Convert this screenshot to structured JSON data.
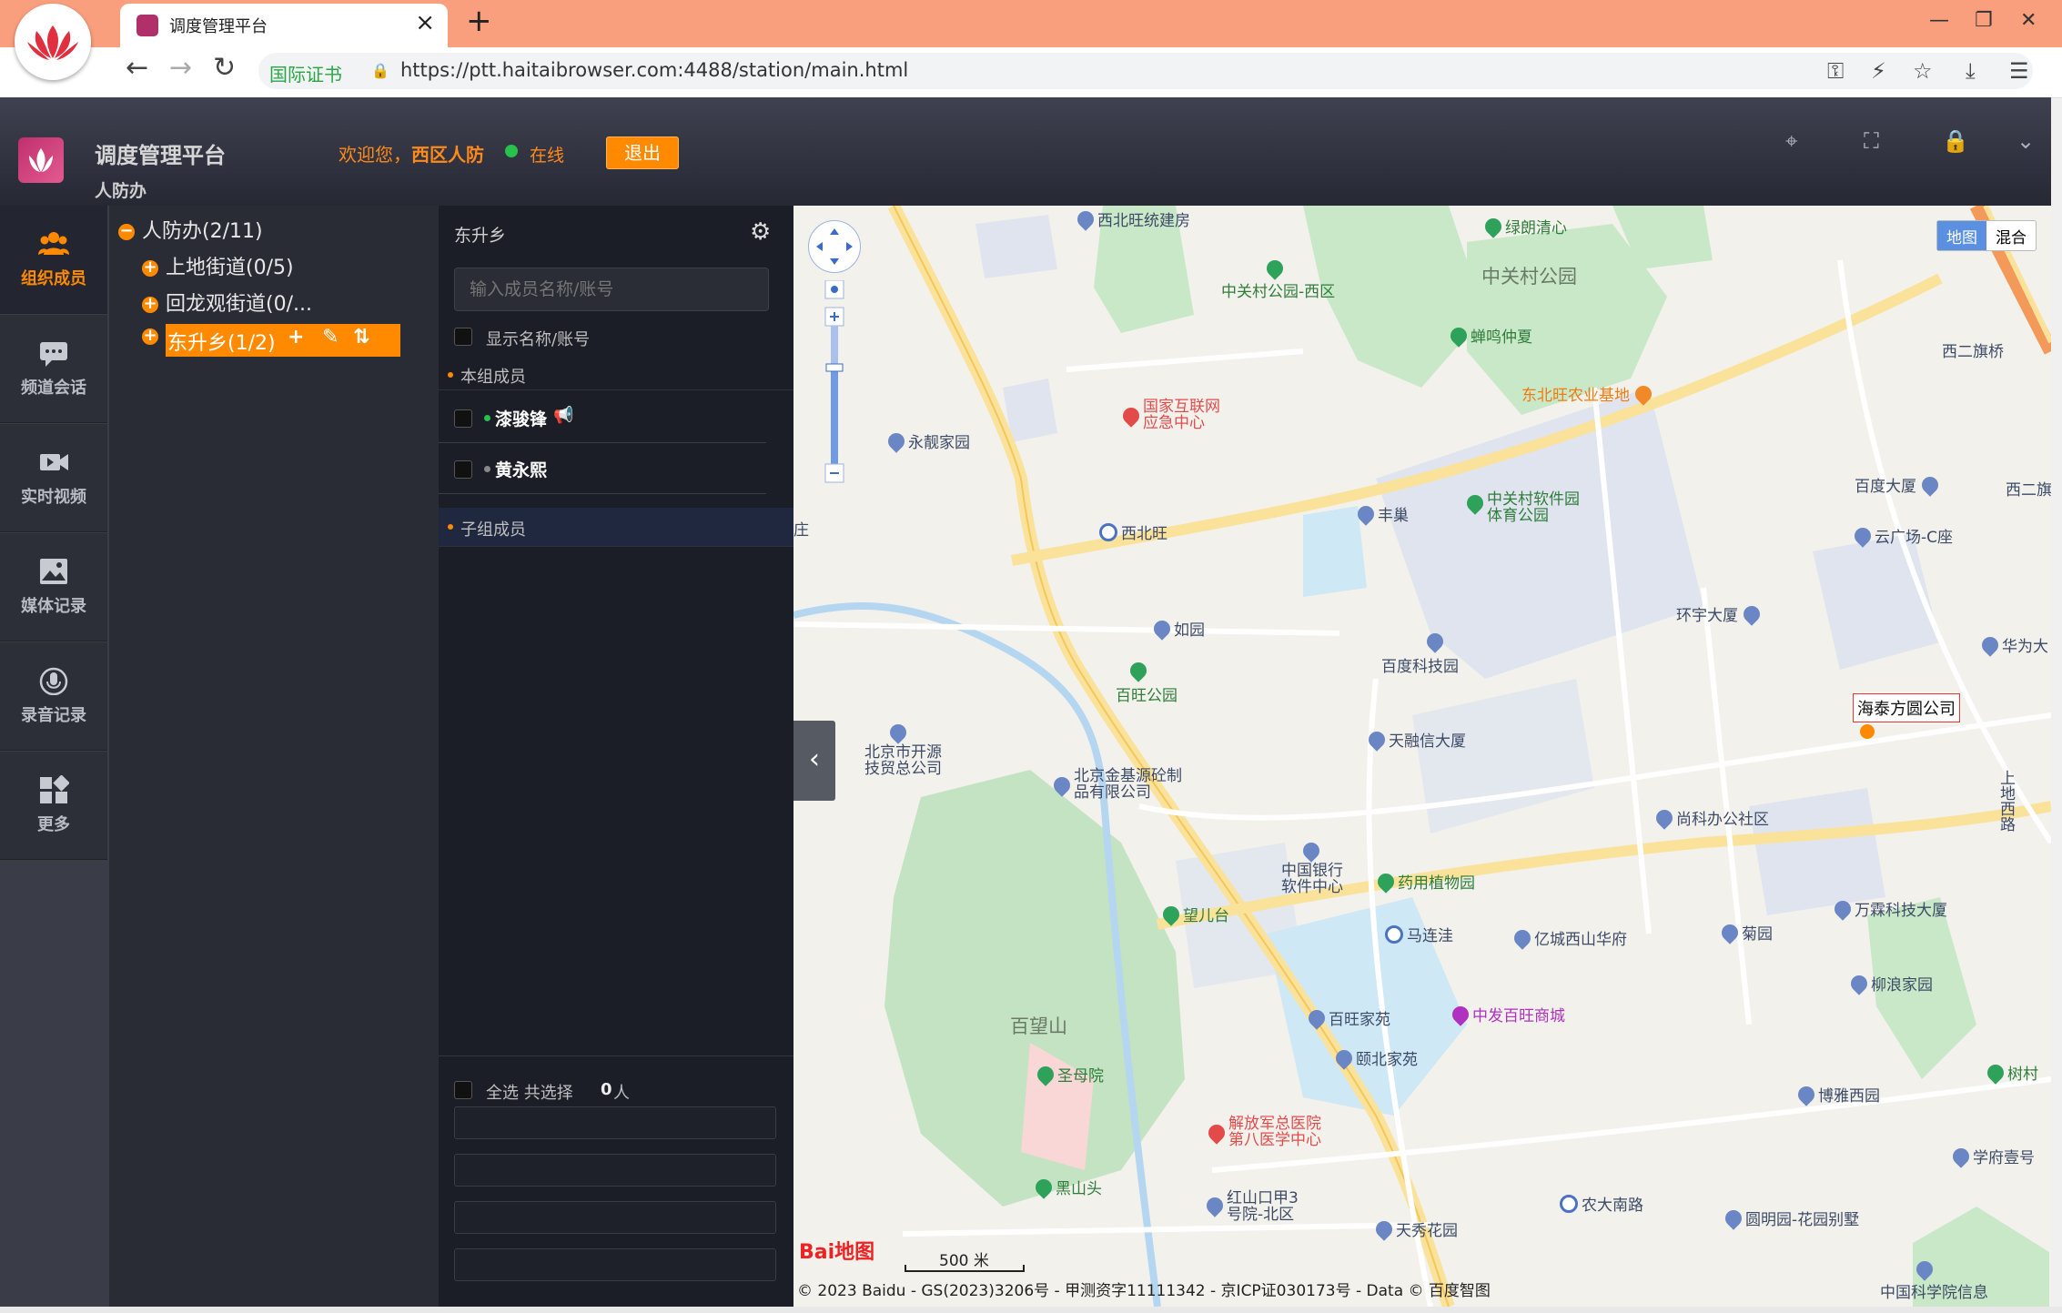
{
  "browser": {
    "tab_title": "调度管理平台",
    "cert_label": "国际证书",
    "url": "https://ptt.haitaibrowser.com:4488/station/main.html"
  },
  "header": {
    "platform_title": "调度管理平台",
    "org_name": "人防办",
    "welcome_prefix": "欢迎您，",
    "user_name": "西区人防",
    "status": "在线",
    "logout_label": "退出"
  },
  "left_nav": [
    {
      "label": "组织成员",
      "icon": "people-icon",
      "active": true
    },
    {
      "label": "频道会话",
      "icon": "chat-icon",
      "active": false
    },
    {
      "label": "实时视频",
      "icon": "video-icon",
      "active": false
    },
    {
      "label": "媒体记录",
      "icon": "image-icon",
      "active": false
    },
    {
      "label": "录音记录",
      "icon": "mic-icon",
      "active": false
    },
    {
      "label": "更多",
      "icon": "apps-icon",
      "active": false
    }
  ],
  "tree": {
    "root": "人防办(2/11)",
    "children": [
      "上地街道(0/5)",
      "回龙观街道(0/...",
      "东升乡(1/2)"
    ],
    "selected_index": 2
  },
  "members": {
    "group_name": "东升乡",
    "search_placeholder": "输入成员名称/账号",
    "show_name_label": "显示名称/账号",
    "own_members_label": "本组成员",
    "list": [
      {
        "name": "漆骏锋",
        "online": true
      },
      {
        "name": "黄永熙",
        "online": false
      }
    ],
    "sub_members_label": "子组成员",
    "select_all_label": "全选 共选择",
    "selected_count": "0",
    "count_unit": "人"
  },
  "map": {
    "type_map": "地图",
    "type_hybrid": "混合",
    "company_label": "海泰方圆公司",
    "scale": "500 米",
    "copyright": "© 2023 Baidu - GS(2023)3206号 - 甲测资字11111342 - 京ICP证030173号 - Data © 百度智图",
    "baidu_logo": "Bai地图",
    "pois": {
      "p1": "西北旺统建房",
      "p2": "绿朗清心",
      "p3": "中关村公园",
      "p4": "中关村公园-西区",
      "p5": "蝉鸣仲夏",
      "p6": "东北旺农业基地",
      "p7": "西二旗桥",
      "p8": "国家互联网应急中心",
      "p9": "永靓家园",
      "p10": "中关村软件园体育公园",
      "p11": "丰巢",
      "p12": "百度大厦",
      "p13": "西二旗",
      "p14": "西北旺",
      "p15": "云广场-C座",
      "p16": "环宇大厦",
      "p17": "如园",
      "p18": "华为大",
      "p19": "百度科技园",
      "p20": "百旺公园",
      "p21": "北京市开源技贸总公司",
      "p22": "天融信大厦",
      "p23": "北京金基源砼制品有限公司",
      "p24": "尚科办公社区",
      "p25": "上地西路",
      "p26": "中国银行软件中心",
      "p27": "药用植物园",
      "p28": "望儿台",
      "p29": "马连洼",
      "p30": "亿城西山华府",
      "p31": "菊园",
      "p32": "万霖科技大厦",
      "p33": "百望山",
      "p34": "中发百旺商城",
      "p35": "柳浪家园",
      "p36": "百旺家苑",
      "p37": "颐北家苑",
      "p38": "圣母院",
      "p39": "树村",
      "p40": "博雅西园",
      "p41": "解放军总医院第八医学中心",
      "p42": "学府壹号",
      "p43": "黑山头",
      "p44": "红山口甲3号院-北区",
      "p45": "农大南路",
      "p46": "天秀花园",
      "p47": "圆明园-花园别墅",
      "p48": "中国科学院信息",
      "p49": "庄"
    }
  }
}
